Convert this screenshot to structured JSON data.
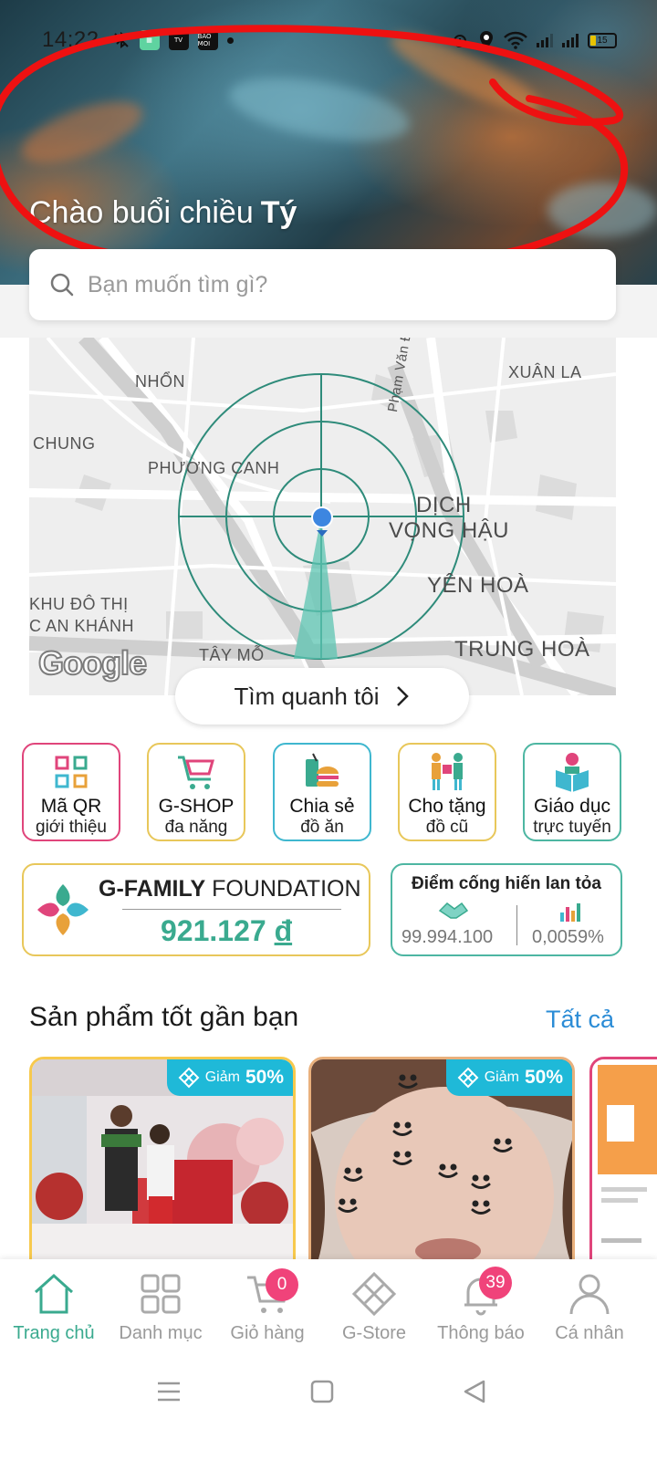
{
  "status_bar": {
    "time": "14:22",
    "app_icon_1": "BAO MOI",
    "battery_level": "15"
  },
  "header": {
    "greeting": "Chào buổi chiều",
    "user_name": "Tý"
  },
  "search": {
    "placeholder": "Bạn muốn tìm gì?"
  },
  "map": {
    "labels": [
      "NHỔN",
      "XUÂN LA",
      "CHUNG",
      "PHƯƠNG CANH",
      "Phạm Văn Đồng",
      "DỊCH",
      "VỌNG HẬU",
      "YÊN HOÀ",
      "KHU ĐÔ THỊ",
      "C AN KHÁNH",
      "TÂY MỖ",
      "TRUNG HOÀ"
    ],
    "logo": "Google",
    "find_button": "Tìm quanh tôi"
  },
  "tiles": [
    {
      "line1": "Mã QR",
      "line2": "giới thiệu",
      "icon": "qr-code-icon",
      "border": "#e0457b"
    },
    {
      "line1": "G-SHOP",
      "line2": "đa năng",
      "icon": "shopping-cart-icon",
      "border": "#e8c75a"
    },
    {
      "line1": "Chia sẻ",
      "line2": "đồ ăn",
      "icon": "food-icon",
      "border": "#3fb7cf"
    },
    {
      "line1": "Cho tặng",
      "line2": "đồ cũ",
      "icon": "donate-icon",
      "border": "#e8c75a"
    },
    {
      "line1": "Giáo dục",
      "line2": "trực tuyến",
      "icon": "education-icon",
      "border": "#4db6a2"
    }
  ],
  "foundation": {
    "title_bold": "G-FAMILY",
    "title_rest": "FOUNDATION",
    "amount": "921.127",
    "currency": "đ"
  },
  "points": {
    "title": "Điểm cống hiến lan tỏa",
    "value1": "99.994.100",
    "value2": "0,0059%"
  },
  "products": {
    "section_title": "Sản phẩm tốt gần bạn",
    "see_all": "Tất cả",
    "discount_prefix": "Giảm",
    "items": [
      {
        "discount": "50%"
      },
      {
        "discount": "50%"
      }
    ]
  },
  "bottom_nav": [
    {
      "label": "Trang chủ",
      "icon": "home-icon",
      "active": true
    },
    {
      "label": "Danh mục",
      "icon": "grid-icon",
      "active": false
    },
    {
      "label": "Giỏ hàng",
      "icon": "cart-icon",
      "badge": "0",
      "active": false
    },
    {
      "label": "G-Store",
      "icon": "store-logo-icon",
      "active": false
    },
    {
      "label": "Thông báo",
      "icon": "bell-icon",
      "badge": "39",
      "active": false
    },
    {
      "label": "Cá nhân",
      "icon": "profile-icon",
      "active": false
    }
  ],
  "colors": {
    "accent_green": "#3aaa8f",
    "link_blue": "#2b8cd6",
    "badge_pink": "#f0437a",
    "discount_cyan": "#1fb9d8",
    "scribble_red": "#ee1111"
  }
}
